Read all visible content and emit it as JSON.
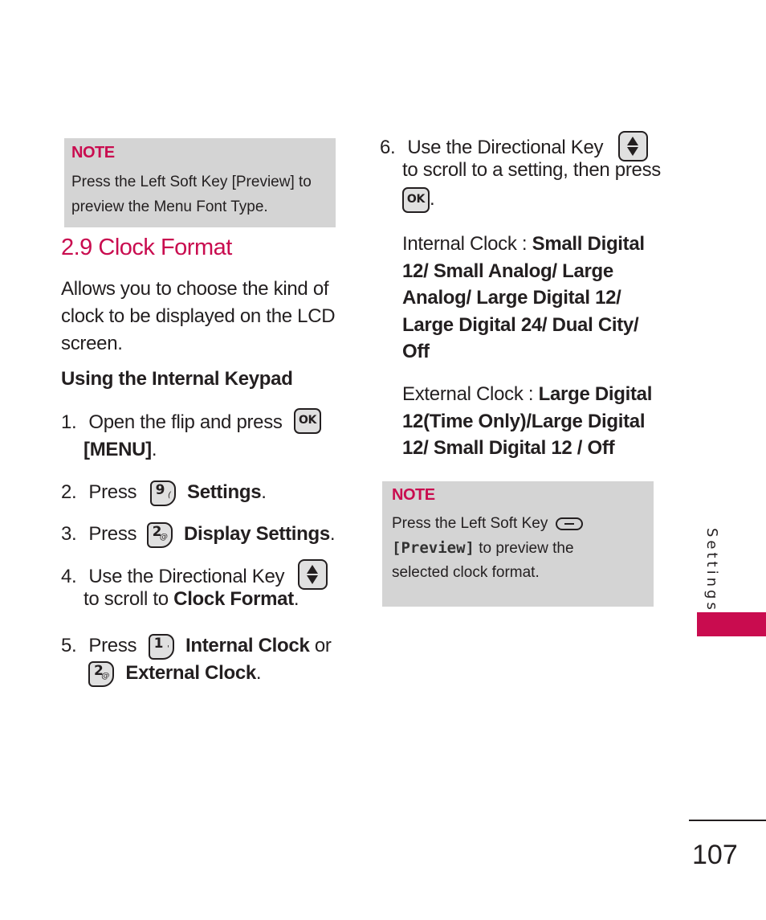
{
  "note1": {
    "title": "NOTE",
    "lines": [
      "Press the Left Soft Key [Preview] to",
      "preview the Menu Font Type."
    ]
  },
  "section": {
    "title": "2.9 Clock Format",
    "description_lines": [
      "Allows you to choose the kind of",
      "clock to be displayed on the LCD",
      "screen."
    ],
    "subheading": "Using the Internal Keypad"
  },
  "steps": [
    {
      "num": "1.",
      "text": "Open the flip and press",
      "key": "ok-key",
      "key_label": "OK",
      "bold": "[MENU]",
      "end": "."
    },
    {
      "num": "2.",
      "text": "Press",
      "key": "9-key",
      "key_digit": "9",
      "key_sym": "(",
      "bold": "Settings",
      "end": "."
    },
    {
      "num": "3.",
      "text": "Press",
      "key": "2-key",
      "key_digit": "2",
      "key_sym": "@",
      "bold": "Display Settings",
      "end": "."
    },
    {
      "num": "4.",
      "text": "Use the Directional Key",
      "key": "directional-key",
      "line2_text": "to scroll to",
      "bold": "Clock Format",
      "end": "."
    },
    {
      "num": "5.",
      "text": "Press",
      "key": "1-key",
      "key_digit": "1",
      "key_sym": "'",
      "bold": "Internal Clock",
      "or": "or",
      "key2": "2-key",
      "key2_digit": "2",
      "key2_sym": "@",
      "bold2": "External Clock",
      "end": "."
    },
    {
      "num": "6.",
      "text": "Use the Directional Key",
      "key": "directional-key",
      "line2_text": "to scroll to a setting, then press",
      "key2": "ok-key",
      "key2_label": "OK",
      "end": "."
    }
  ],
  "internal_clock": {
    "label": "Internal Clock : ",
    "lines": [
      "Small Digital",
      "12/ Small Analog/ Large",
      "Analog/ Large Digital 12/",
      "Large Digital 24/ Dual City/",
      "Off"
    ]
  },
  "external_clock": {
    "label": "External Clock : ",
    "lines": [
      "Large Digital",
      "12(Time Only)/Large Digital",
      "12/ Small Digital 12 / Off"
    ]
  },
  "note2": {
    "title": "NOTE",
    "line1": "Press the Left Soft Key",
    "preview": "[Preview]",
    "line2_rest": " to preview the",
    "line3": "selected clock format."
  },
  "side_tab": {
    "label": "Settings",
    "color": "#c90c4f"
  },
  "page_number": "107",
  "colors": {
    "accent": "#c90c4f",
    "note_bg": "#d4d4d4",
    "text": "#231f20"
  }
}
